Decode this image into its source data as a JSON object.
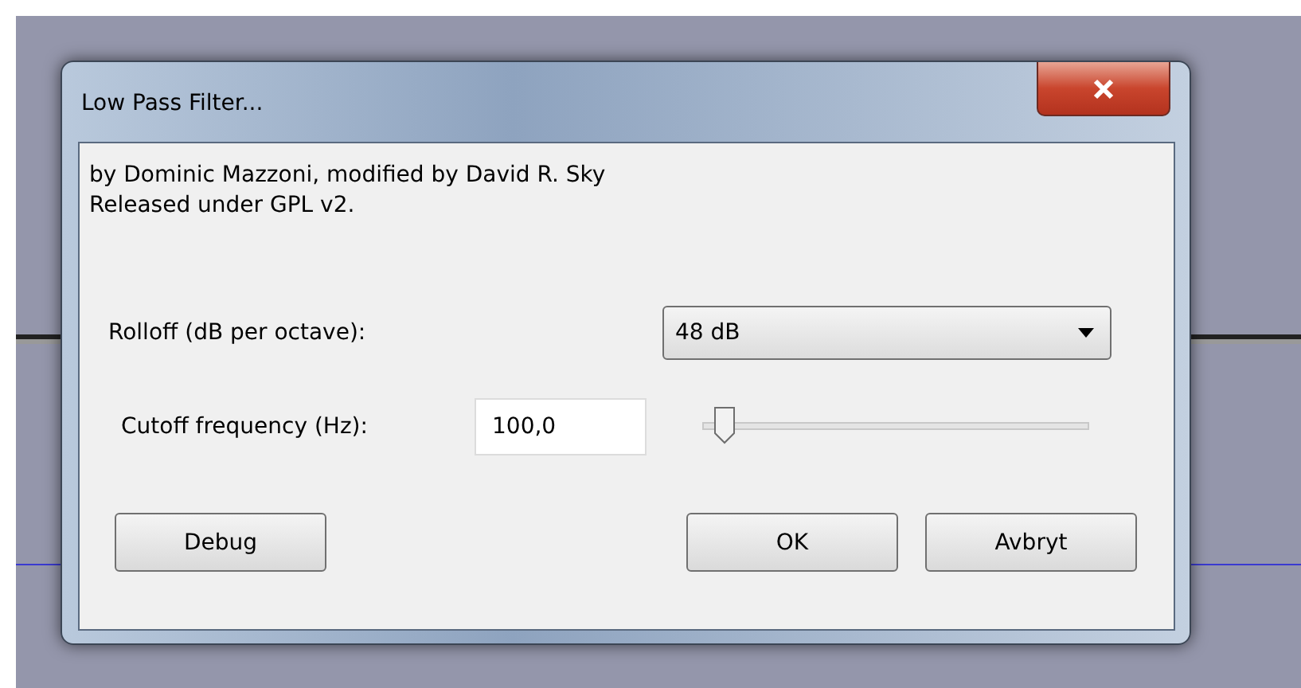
{
  "window": {
    "title": "Low Pass Filter..."
  },
  "credits": [
    "by Dominic Mazzoni, modified by David R. Sky",
    "Released under GPL v2."
  ],
  "rolloff": {
    "label": "Rolloff (dB per octave):",
    "value": "48 dB"
  },
  "cutoff": {
    "label": "Cutoff frequency (Hz):",
    "value": "100,0",
    "level": 0.03
  },
  "buttons": [
    {
      "label": "Debug",
      "kind": "left"
    },
    {
      "label": "OK",
      "kind": "right"
    },
    {
      "label": "Avbryt",
      "kind": "right"
    }
  ]
}
